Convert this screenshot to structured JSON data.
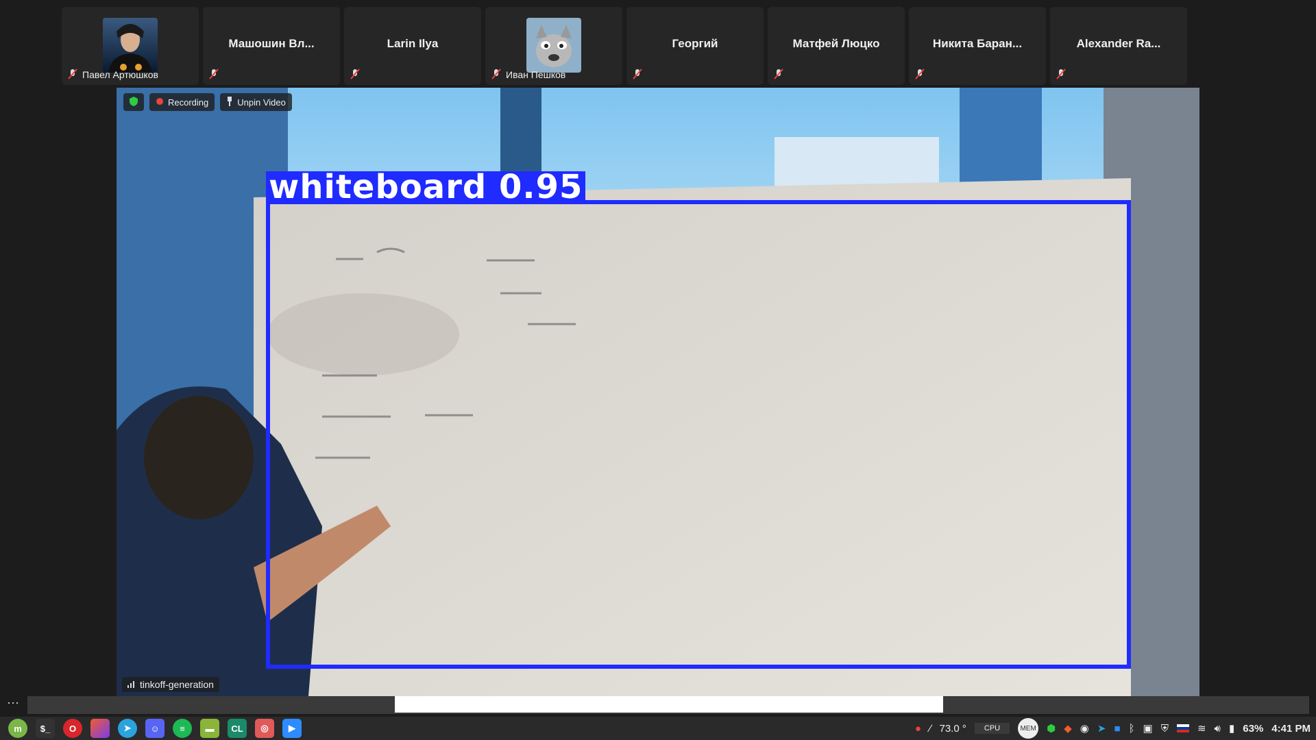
{
  "participants": [
    {
      "name": "",
      "label": "Павел Артюшков",
      "has_avatar": true
    },
    {
      "name": "Машошин Вл...",
      "label": ""
    },
    {
      "name": "Larin Ilya",
      "label": ""
    },
    {
      "name": "",
      "label": "Иван Пешков",
      "has_avatar": true
    },
    {
      "name": "Георгий",
      "label": ""
    },
    {
      "name": "Матфей Люцко",
      "label": ""
    },
    {
      "name": "Никита Баран...",
      "label": ""
    },
    {
      "name": "Alexander Ra...",
      "label": ""
    }
  ],
  "video": {
    "recording_label": "Recording",
    "unpin_label": "Unpin Video",
    "host_label": "tinkoff-generation",
    "detection_label": "whiteboard 0.95",
    "detection_color": "#1f2bff"
  },
  "tray": {
    "temperature": "73.0 °",
    "cpu_label": "CPU",
    "mem_label": "MEM",
    "battery": "63%",
    "time": "4:41 PM"
  },
  "colors": {
    "accent": "#1f2bff",
    "recording": "#e8453c",
    "shield": "#2ecc40"
  }
}
